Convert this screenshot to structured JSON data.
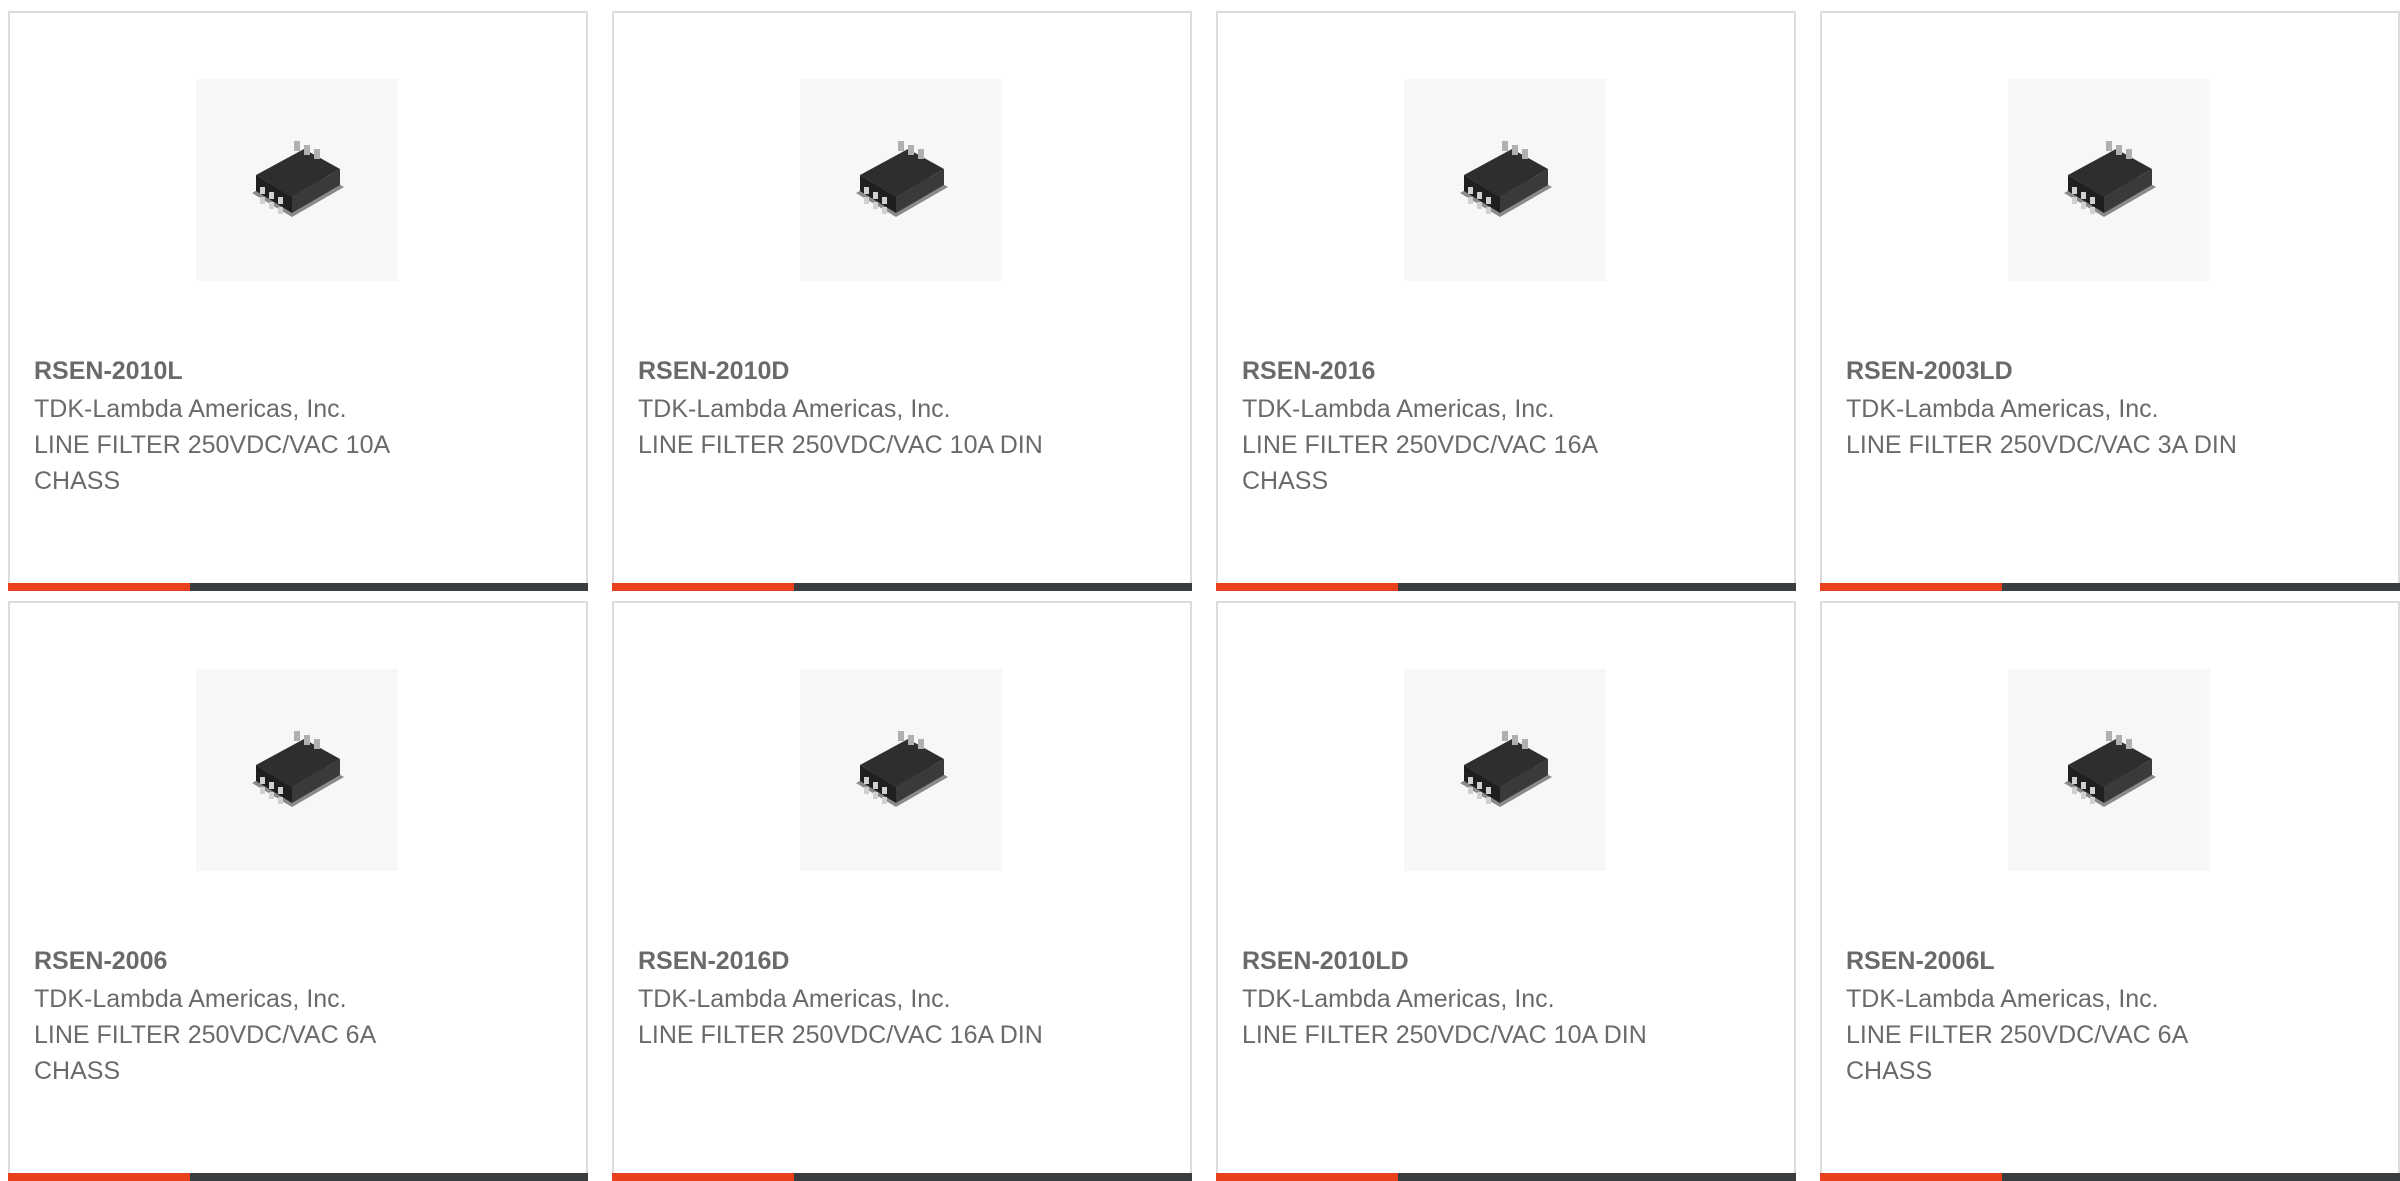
{
  "colors": {
    "accent": "#e8411c",
    "bar": "#3a3d40",
    "text": "#6a6a6a",
    "border": "#dcdcdc"
  },
  "image_icon": "line-filter-chassis-image",
  "products": [
    {
      "part_number": "RSEN-2010L",
      "manufacturer": "TDK-Lambda Americas, Inc.",
      "description": "LINE FILTER 250VDC/VAC 10A CHASS"
    },
    {
      "part_number": "RSEN-2010D",
      "manufacturer": "TDK-Lambda Americas, Inc.",
      "description": "LINE FILTER 250VDC/VAC 10A DIN"
    },
    {
      "part_number": "RSEN-2016",
      "manufacturer": "TDK-Lambda Americas, Inc.",
      "description": "LINE FILTER 250VDC/VAC 16A CHASS"
    },
    {
      "part_number": "RSEN-2003LD",
      "manufacturer": "TDK-Lambda Americas, Inc.",
      "description": "LINE FILTER 250VDC/VAC 3A DIN"
    },
    {
      "part_number": "RSEN-2006",
      "manufacturer": "TDK-Lambda Americas, Inc.",
      "description": "LINE FILTER 250VDC/VAC 6A CHASS"
    },
    {
      "part_number": "RSEN-2016D",
      "manufacturer": "TDK-Lambda Americas, Inc.",
      "description": "LINE FILTER 250VDC/VAC 16A DIN"
    },
    {
      "part_number": "RSEN-2010LD",
      "manufacturer": "TDK-Lambda Americas, Inc.",
      "description": "LINE FILTER 250VDC/VAC 10A DIN"
    },
    {
      "part_number": "RSEN-2006L",
      "manufacturer": "TDK-Lambda Americas, Inc.",
      "description": "LINE FILTER 250VDC/VAC 6A CHASS"
    }
  ]
}
